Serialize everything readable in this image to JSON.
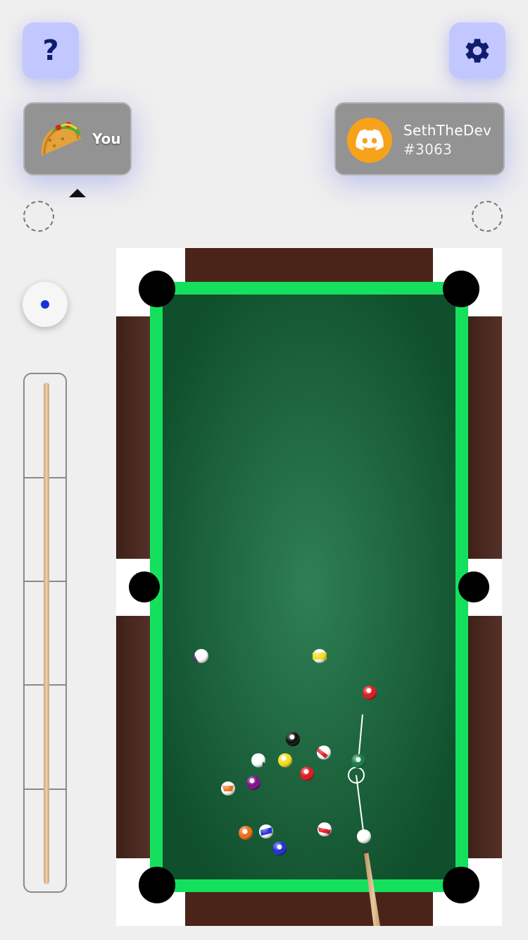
{
  "header": {
    "help_label": "?",
    "help_icon": "question-mark-icon",
    "settings_icon": "gear-icon"
  },
  "players": [
    {
      "name": "You",
      "avatar": "taco-icon",
      "active": true
    },
    {
      "name": "SethTheDev",
      "tag": "#3063",
      "avatar": "discord-icon",
      "avatar_color": "#f7a21b"
    }
  ],
  "colors": {
    "felt": "#1e6b42",
    "cushion": "#14e05e",
    "rail": "#4a2a20",
    "button_bg": "#c2c8ff",
    "card_bg": "#939393",
    "spin_dot": "#1434d8"
  },
  "shot_power": 0,
  "balls": [
    {
      "name": "cue-ball",
      "color": "#ffffff",
      "type": "cue"
    },
    {
      "name": "ball-1",
      "color": "#f4dd1a",
      "type": "solid"
    },
    {
      "name": "ball-2",
      "color": "#1a2ad6",
      "type": "solid"
    },
    {
      "name": "ball-3",
      "color": "#e0121a",
      "type": "solid"
    },
    {
      "name": "ball-4",
      "color": "#7a0a8c",
      "type": "solid"
    },
    {
      "name": "ball-5",
      "color": "#ec6a12",
      "type": "solid"
    },
    {
      "name": "ball-6",
      "color": "#0e7a3e",
      "type": "solid"
    },
    {
      "name": "ball-7",
      "color": "#e0121a",
      "type": "solid"
    },
    {
      "name": "ball-8",
      "color": "#0a0a0a",
      "type": "solid"
    },
    {
      "name": "ball-9",
      "color": "#f4dd1a",
      "type": "stripe"
    },
    {
      "name": "ball-10",
      "color": "#1a2ad6",
      "type": "stripe"
    },
    {
      "name": "ball-11",
      "color": "#e0121a",
      "type": "stripe"
    },
    {
      "name": "ball-12",
      "color": "#7a0a8c",
      "type": "stripe"
    },
    {
      "name": "ball-13",
      "color": "#ec6a12",
      "type": "stripe"
    },
    {
      "name": "ball-14",
      "color": "#0e7a3e",
      "type": "stripe"
    },
    {
      "name": "ball-15",
      "color": "#e0121a",
      "type": "stripe"
    }
  ]
}
